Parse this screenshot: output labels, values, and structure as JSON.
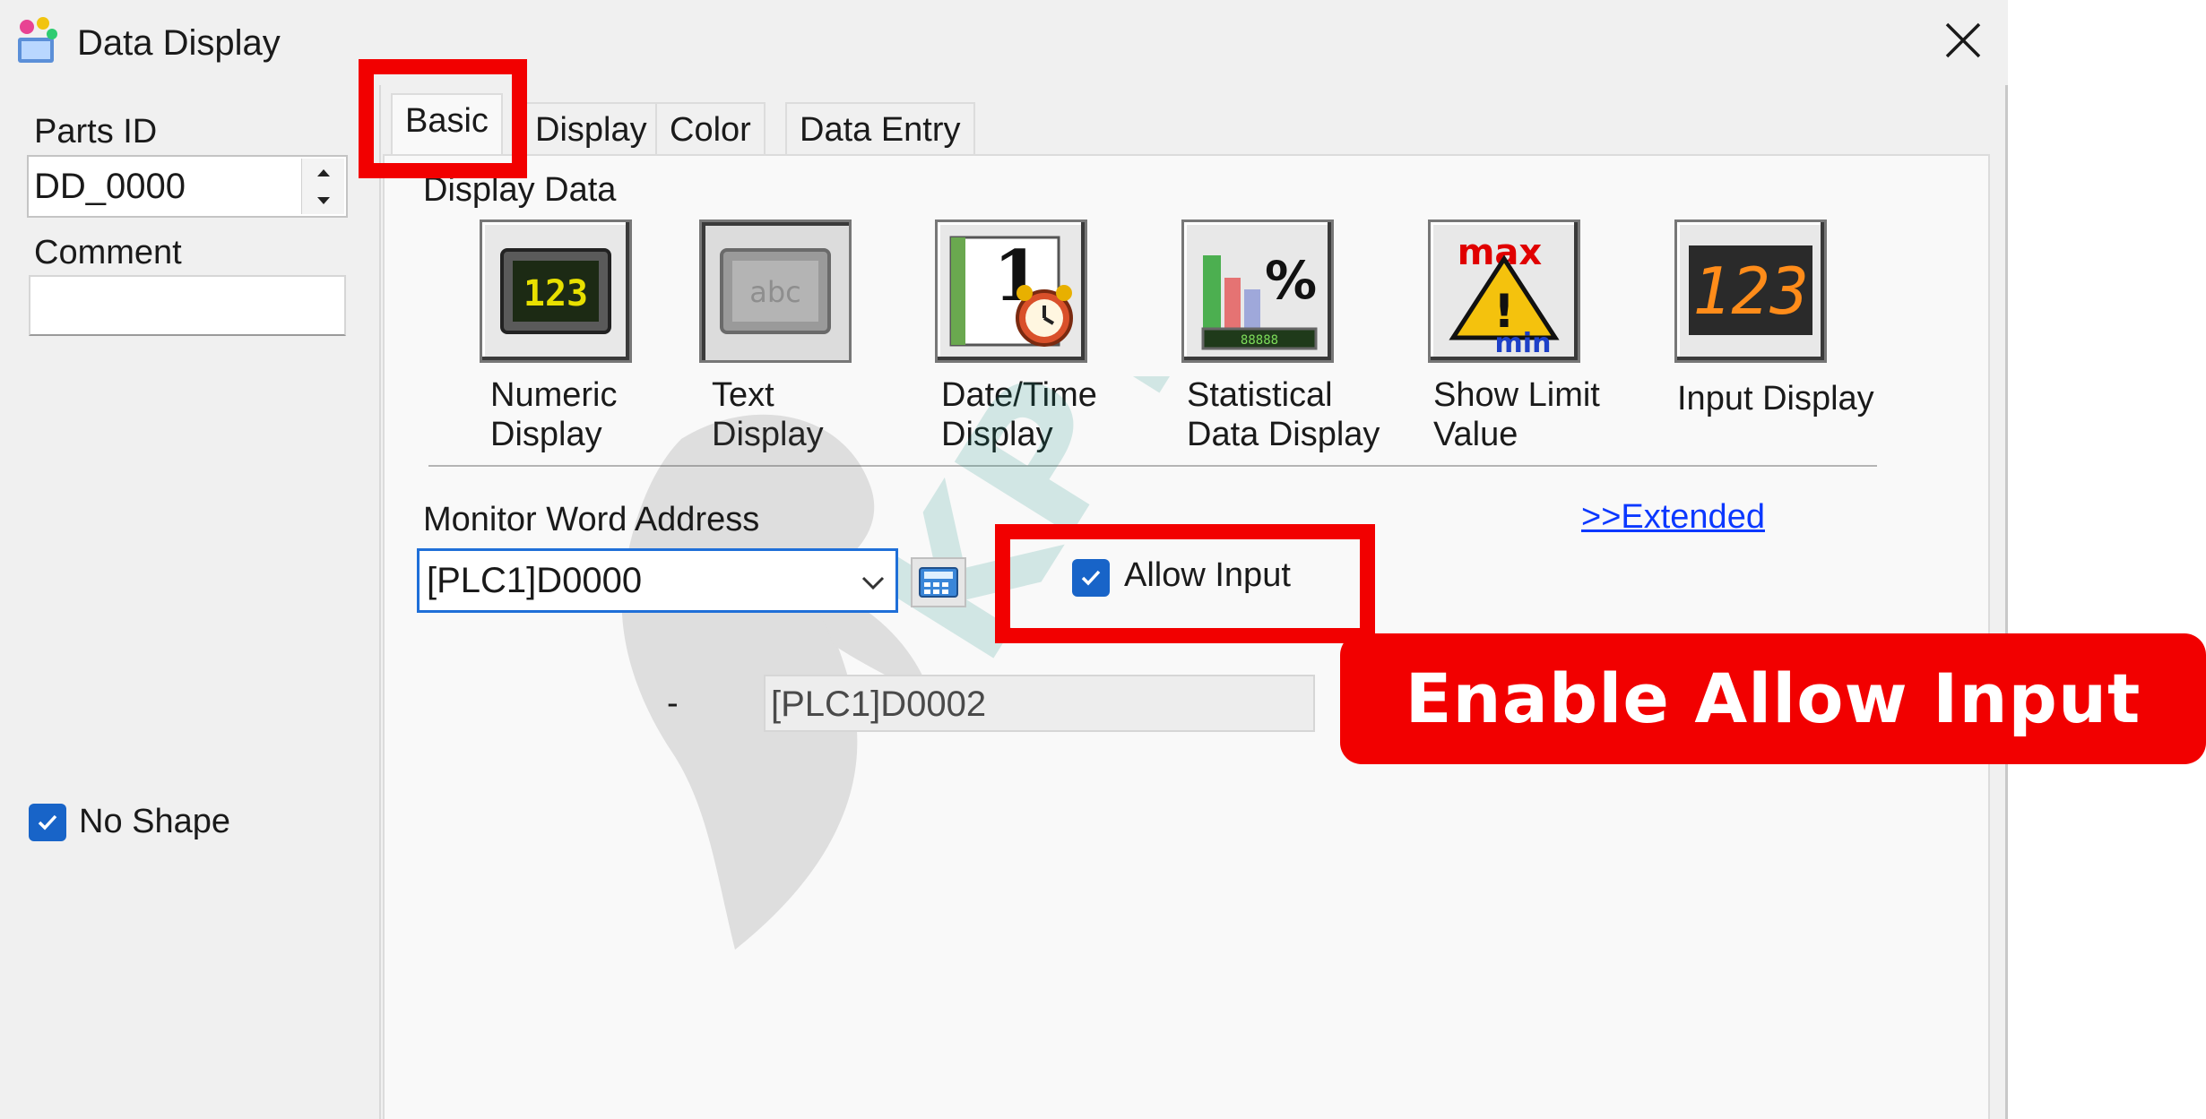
{
  "window": {
    "title": "Data Display"
  },
  "left": {
    "parts_id_label": "Parts ID",
    "parts_id_value": "DD_0000",
    "comment_label": "Comment",
    "comment_value": "",
    "no_shape_label": "No Shape",
    "no_shape_checked": true
  },
  "tabs": [
    {
      "label": "Basic",
      "active": true
    },
    {
      "label": "Display",
      "active": false
    },
    {
      "label": "Color",
      "active": false
    },
    {
      "label": "Data Entry",
      "active": false
    }
  ],
  "basic": {
    "display_data_label": "Display Data",
    "display_types": [
      {
        "icon": "numeric-display-icon",
        "line1": "Numeric",
        "line2": "Display",
        "selected": false
      },
      {
        "icon": "text-display-icon",
        "line1": "Text",
        "line2": "Display",
        "selected": true
      },
      {
        "icon": "datetime-display-icon",
        "line1": "Date/Time",
        "line2": "Display",
        "selected": false
      },
      {
        "icon": "statistical-display-icon",
        "line1": "Statistical",
        "line2": "Data Display",
        "selected": false
      },
      {
        "icon": "show-limit-icon",
        "line1": "Show Limit",
        "line2": "Value",
        "selected": false
      },
      {
        "icon": "input-display-icon",
        "line1": "Input Display",
        "line2": "",
        "selected": false
      }
    ],
    "monitor_label": "Monitor Word Address",
    "monitor_value": "[PLC1]D0000",
    "extended_link": ">>Extended",
    "allow_input_label": "Allow Input",
    "allow_input_checked": true,
    "range_dash": "-",
    "range_end_value": "[PLC1]D0002"
  },
  "annotation": {
    "callout_text": "Enable Allow Input",
    "color": "#f20000"
  },
  "colors": {
    "accent": "#1864c8",
    "link": "#0b38ff",
    "highlight": "#f20000"
  }
}
